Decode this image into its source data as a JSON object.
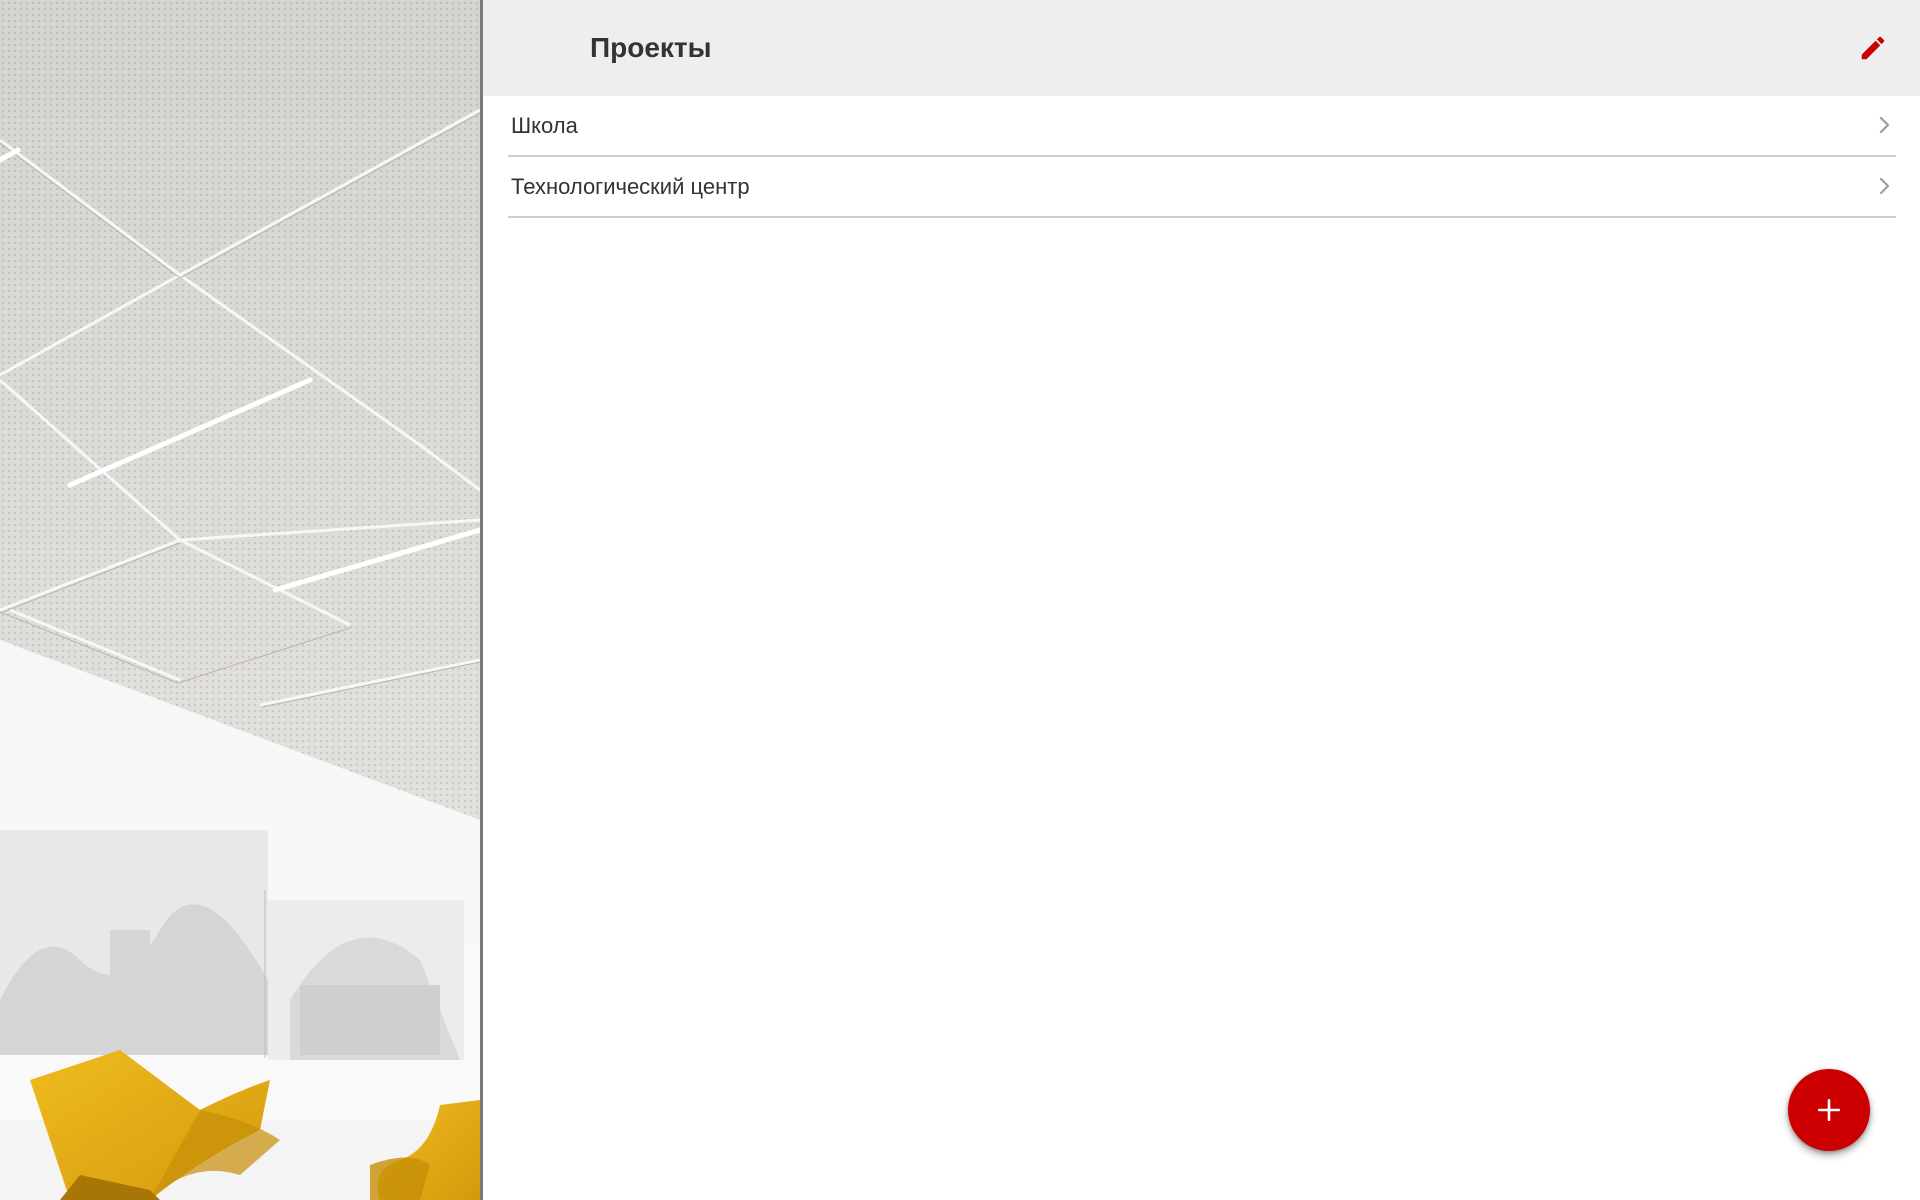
{
  "header": {
    "title": "Проекты",
    "edit_icon": "pencil-icon"
  },
  "projects": [
    {
      "label": "Школа",
      "icon": "chevron-right-icon"
    },
    {
      "label": "Технологический центр",
      "icon": "chevron-right-icon"
    }
  ],
  "fab": {
    "icon": "plus-icon"
  },
  "colors": {
    "accent": "#cc0000",
    "app_bar": "#eeeeee",
    "text": "#333333",
    "divider": "#cfcfcf",
    "chair": "#e2aa14"
  }
}
